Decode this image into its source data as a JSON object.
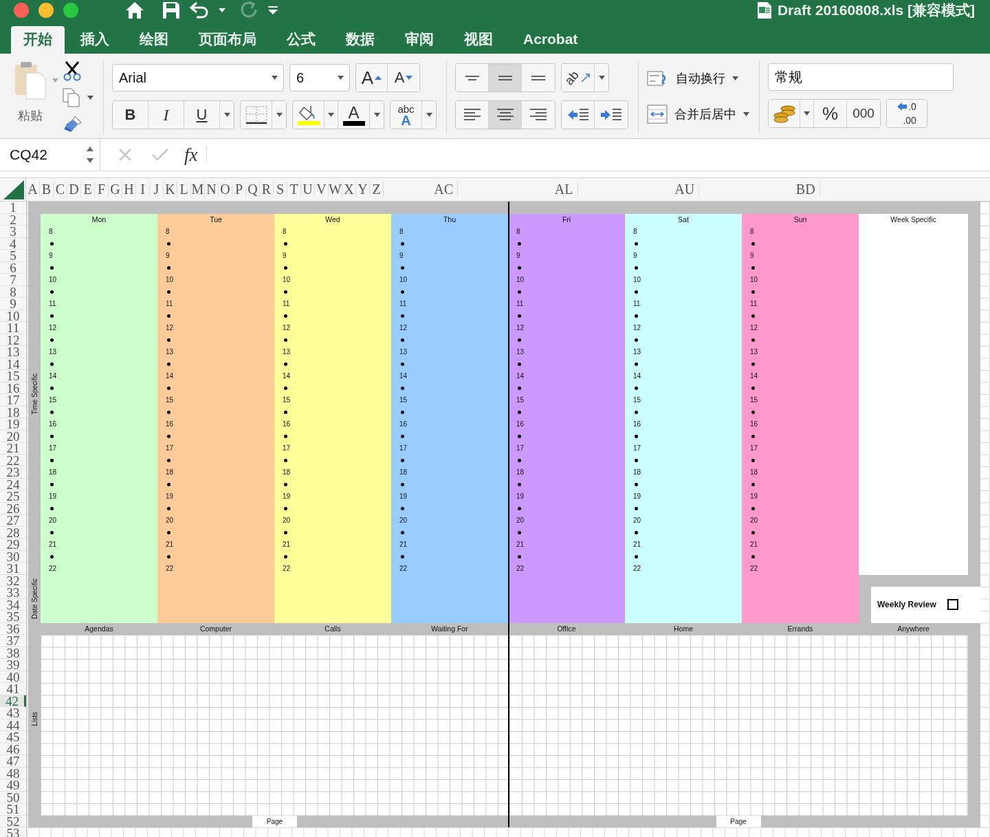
{
  "window": {
    "title": "Draft 20160808.xls [兼容模式]"
  },
  "quick_access": {
    "redo": {
      "disabled": true
    }
  },
  "tabs": [
    {
      "label": "开始",
      "selected": true
    },
    {
      "label": "插入",
      "selected": false
    },
    {
      "label": "绘图",
      "selected": false
    },
    {
      "label": "页面布局",
      "selected": false
    },
    {
      "label": "公式",
      "selected": false
    },
    {
      "label": "数据",
      "selected": false
    },
    {
      "label": "审阅",
      "selected": false
    },
    {
      "label": "视图",
      "selected": false
    },
    {
      "label": "Acrobat",
      "selected": false
    }
  ],
  "ribbon": {
    "paste_label": "粘贴",
    "font_name": "Arial",
    "font_size": "6",
    "grow_font": "A",
    "shrink_font": "A",
    "bold": "B",
    "italic": "I",
    "underline": "U",
    "font_color": "A",
    "abc": [
      "abc",
      "A"
    ],
    "orientation": "ab",
    "vertical_align": [
      {
        "kind": "top",
        "selected": false
      },
      {
        "kind": "middle",
        "selected": true
      },
      {
        "kind": "bottom",
        "selected": false
      }
    ],
    "horizontal_align": [
      {
        "kind": "left",
        "selected": false
      },
      {
        "kind": "center",
        "selected": true
      },
      {
        "kind": "right",
        "selected": false
      }
    ],
    "wrap_text": "自动换行",
    "merge_center": "合并后居中",
    "number_format": "常规",
    "percent": "%",
    "thousands": "000",
    "increase_decimal": [
      ".0",
      ".00"
    ]
  },
  "formula_bar": {
    "name_box": "CQ42",
    "fx": "fx"
  },
  "column_headers": [
    "A",
    "B",
    "C",
    "D",
    "E",
    "F",
    "G",
    "H",
    "I",
    "J",
    "K",
    "L",
    "M",
    "N",
    "O",
    "P",
    "Q",
    "R",
    "S",
    "T",
    "U",
    "V",
    "W",
    "X",
    "Y",
    "Z"
  ],
  "far_column_headers": [
    "AC",
    "AL",
    "AU",
    "BD"
  ],
  "row_headers": [
    {
      "label": "1",
      "selected": false
    },
    {
      "label": "2",
      "selected": false
    },
    {
      "label": "3",
      "selected": false
    },
    {
      "label": "4",
      "selected": false
    },
    {
      "label": "5",
      "selected": false
    },
    {
      "label": "6",
      "selected": false
    },
    {
      "label": "7",
      "selected": false
    },
    {
      "label": "8",
      "selected": false
    },
    {
      "label": "9",
      "selected": false
    },
    {
      "label": "10",
      "selected": false
    },
    {
      "label": "11",
      "selected": false
    },
    {
      "label": "12",
      "selected": false
    },
    {
      "label": "13",
      "selected": false
    },
    {
      "label": "14",
      "selected": false
    },
    {
      "label": "15",
      "selected": false
    },
    {
      "label": "16",
      "selected": false
    },
    {
      "label": "17",
      "selected": false
    },
    {
      "label": "18",
      "selected": false
    },
    {
      "label": "19",
      "selected": false
    },
    {
      "label": "20",
      "selected": false
    },
    {
      "label": "21",
      "selected": false
    },
    {
      "label": "22",
      "selected": false
    },
    {
      "label": "23",
      "selected": false
    },
    {
      "label": "24",
      "selected": false
    },
    {
      "label": "25",
      "selected": false
    },
    {
      "label": "26",
      "selected": false
    },
    {
      "label": "27",
      "selected": false
    },
    {
      "label": "28",
      "selected": false
    },
    {
      "label": "29",
      "selected": false
    },
    {
      "label": "30",
      "selected": false
    },
    {
      "label": "31",
      "selected": false
    },
    {
      "label": "32",
      "selected": false
    },
    {
      "label": "33",
      "selected": false
    },
    {
      "label": "34",
      "selected": false
    },
    {
      "label": "35",
      "selected": false
    },
    {
      "label": "36",
      "selected": false
    },
    {
      "label": "37",
      "selected": false
    },
    {
      "label": "38",
      "selected": false
    },
    {
      "label": "39",
      "selected": false
    },
    {
      "label": "40",
      "selected": false
    },
    {
      "label": "41",
      "selected": false
    },
    {
      "label": "42",
      "selected": true
    },
    {
      "label": "43",
      "selected": false
    },
    {
      "label": "44",
      "selected": false
    },
    {
      "label": "45",
      "selected": false
    },
    {
      "label": "46",
      "selected": false
    },
    {
      "label": "47",
      "selected": false
    },
    {
      "label": "48",
      "selected": false
    },
    {
      "label": "49",
      "selected": false
    },
    {
      "label": "50",
      "selected": false
    },
    {
      "label": "51",
      "selected": false
    },
    {
      "label": "52",
      "selected": false
    },
    {
      "label": "53",
      "selected": false
    }
  ],
  "planner": {
    "side_labels": [
      "Time Specific",
      "Date Specific",
      "Lists"
    ],
    "days": [
      {
        "name": "Mon",
        "color": "#ccffcc",
        "hours": [
          "8",
          "9",
          "10",
          "11",
          "12",
          "13",
          "14",
          "15",
          "16",
          "17",
          "18",
          "19",
          "20",
          "21",
          "22"
        ]
      },
      {
        "name": "Tue",
        "color": "#ffcc99",
        "hours": [
          "8",
          "9",
          "10",
          "11",
          "12",
          "13",
          "14",
          "15",
          "16",
          "17",
          "18",
          "19",
          "20",
          "21",
          "22"
        ]
      },
      {
        "name": "Wed",
        "color": "#ffff99",
        "hours": [
          "8",
          "9",
          "10",
          "11",
          "12",
          "13",
          "14",
          "15",
          "16",
          "17",
          "18",
          "19",
          "20",
          "21",
          "22"
        ]
      },
      {
        "name": "Thu",
        "color": "#99ccff",
        "hours": [
          "8",
          "9",
          "10",
          "11",
          "12",
          "13",
          "14",
          "15",
          "16",
          "17",
          "18",
          "19",
          "20",
          "21",
          "22"
        ]
      },
      {
        "name": "Fri",
        "color": "#cc99ff",
        "hours": [
          "8",
          "9",
          "10",
          "11",
          "12",
          "13",
          "14",
          "15",
          "16",
          "17",
          "18",
          "19",
          "20",
          "21",
          "22"
        ]
      },
      {
        "name": "Sat",
        "color": "#ccffff",
        "hours": [
          "8",
          "9",
          "10",
          "11",
          "12",
          "13",
          "14",
          "15",
          "16",
          "17",
          "18",
          "19",
          "20",
          "21",
          "22"
        ]
      },
      {
        "name": "Sun",
        "color": "#ff99cc",
        "hours": [
          "8",
          "9",
          "10",
          "11",
          "12",
          "13",
          "14",
          "15",
          "16",
          "17",
          "18",
          "19",
          "20",
          "21",
          "22"
        ]
      }
    ],
    "week_specific": "Week Specific",
    "weekly_review": {
      "label": "Weekly Review",
      "checked": false
    },
    "lists": [
      "Agendas",
      "Computer",
      "Calls",
      "Waiting For",
      "Office",
      "Home",
      "Errands",
      "Anywhere"
    ],
    "page_labels": [
      "Page",
      "Page"
    ]
  }
}
